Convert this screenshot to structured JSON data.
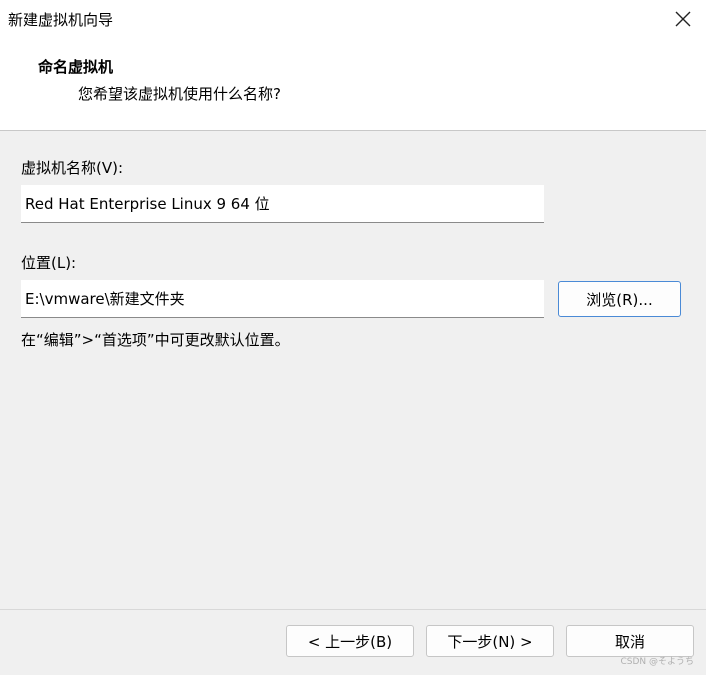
{
  "window": {
    "title": "新建虚拟机向导",
    "close_icon": "close-icon"
  },
  "header": {
    "title": "命名虚拟机",
    "subtitle": "您希望该虚拟机使用什么名称?"
  },
  "form": {
    "name_label": "虚拟机名称(V):",
    "name_value": "Red Hat Enterprise Linux 9 64 位",
    "location_label": "位置(L):",
    "location_value": "E:\\vmware\\新建文件夹",
    "browse_label": "浏览(R)...",
    "hint": "在“编辑”>“首选项”中可更改默认位置。"
  },
  "footer": {
    "back_label": "< 上一步(B)",
    "next_label": "下一步(N) >",
    "cancel_label": "取消"
  },
  "watermark": "CSDN @そようち"
}
